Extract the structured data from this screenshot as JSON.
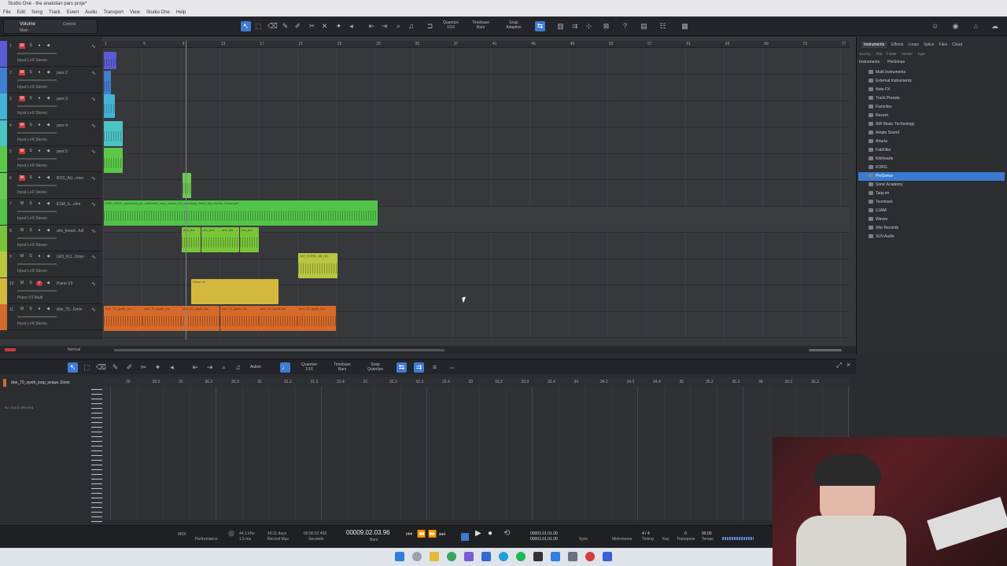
{
  "window": {
    "title": "Studio One - the anatolian pars proje*"
  },
  "menu": [
    "File",
    "Edit",
    "Song",
    "Track",
    "Event",
    "Audio",
    "Transport",
    "View",
    "Studio One",
    "Help"
  ],
  "toolbar": {
    "volume_label": "Volume",
    "volume_sub": "Main",
    "control_label": "Control",
    "quantize_label": "Quantize",
    "quantize_val": "1/16",
    "timebase_label": "Timebase",
    "timebase_val": "Bars",
    "snap_label": "Snap",
    "snap_val": "Adaptive"
  },
  "ruler": [
    "1",
    "5",
    "9",
    "13",
    "17",
    "21",
    "25",
    "29",
    "33",
    "37",
    "41",
    "45",
    "49",
    "53",
    "57",
    "61",
    "65",
    "69",
    "73",
    "77"
  ],
  "tracks": [
    {
      "num": "1",
      "name": "",
      "input": "Input L+R   Stereo",
      "color": "#5b5bd6",
      "mute": true
    },
    {
      "num": "2",
      "name": "pars 2",
      "input": "Input L+R   Stereo",
      "color": "#3f7fd0",
      "mute": true
    },
    {
      "num": "3",
      "name": "pars 3",
      "input": "Input L+R   Stereo",
      "color": "#43b4d8",
      "mute": true
    },
    {
      "num": "4",
      "name": "pars 4",
      "input": "Input L+R   Stereo",
      "color": "#4cc4c4",
      "mute": true
    },
    {
      "num": "5",
      "name": "pars 5",
      "input": "Input L+R   Stereo",
      "color": "#5cc84a",
      "mute": true
    },
    {
      "num": "6",
      "name": "BOS_AU...mon",
      "input": "Input L+R   Stereo",
      "color": "#6acb52",
      "mute": true
    },
    {
      "num": "7",
      "name": "ESM_S...ckm",
      "input": "Input L+R   Stereo",
      "color": "#52c44a",
      "mute": false
    },
    {
      "num": "8",
      "name": "ahs_feeart...full",
      "input": "Input L+R   Stereo",
      "color": "#7ac43a",
      "mute": false
    },
    {
      "num": "9",
      "name": "GIO_KO...Dmin",
      "input": "Input L+R   Stereo",
      "color": "#b8c640",
      "mute": false
    },
    {
      "num": "10",
      "name": "Piano V3",
      "input": "Piano V3     Multi",
      "color": "#d4b83e",
      "mute": false
    },
    {
      "num": "11",
      "name": "doe_70...Dmin",
      "input": "Input L+R   Stereo",
      "color": "#d66a2a",
      "mute": false
    }
  ],
  "clips": {
    "esm": "ESM_SKOL_pianosolo_pc_ambience_loop_cream_full_drumloop_feem_full_chords_fullsample",
    "ahs": "ahs_fea",
    "gio": "GIO_KORG_85_Dm",
    "piano": "Piano V3",
    "doe": "doe_70_synth_loo"
  },
  "browser": {
    "tabs": [
      "Instruments",
      "Effects",
      "Loops",
      "Splice",
      "Files",
      "Cloud"
    ],
    "filters": [
      "Sort by:",
      "Flat",
      "Folder",
      "Vendor",
      "Type"
    ],
    "path": [
      "Instruments",
      "PreSonus"
    ],
    "items": [
      "Multi Instruments",
      "External Instruments",
      "Note FX",
      "Track Presets",
      "Favorites",
      "Recent",
      "AIR Music Technology",
      "Ample Sound",
      "Arturia",
      "FabFilter",
      "Kilohearts",
      "KORG",
      "PreSonus",
      "Sonic Academy",
      "Taqs.im",
      "Toontrack",
      "UJAM",
      "Waves",
      "Xfer Records",
      "XLN Audio"
    ],
    "selected": "PreSonus"
  },
  "editor": {
    "track": "doe_70_synth_loop_seque..Dmin",
    "no_chord": "No chord selected",
    "action": "Action",
    "quantize_label": "Quantize",
    "quantize_val": "1/16",
    "timebase_label": "Timebase",
    "timebase_val": "Bars",
    "snap_label": "Snap",
    "snap_val": "Quantize",
    "ruler": [
      "29",
      "29.2",
      "30",
      "30.2",
      "30.3",
      "31",
      "31.2",
      "31.3",
      "31.4",
      "32",
      "32.2",
      "32.3",
      "32.4",
      "33",
      "33.2",
      "33.3",
      "33.4",
      "34",
      "34.2",
      "34.3",
      "34.4",
      "35",
      "35.2",
      "35.3",
      "36",
      "36.2",
      "36.3"
    ]
  },
  "transport": {
    "rate": "44.1 kHz",
    "rate_sub": "1.5 ms",
    "record_max": "43:11 days",
    "record_max_label": "Record Max",
    "seconds": "00:00:22.493",
    "seconds_label": "Seconds",
    "bars": "00009.02.03.96",
    "bars_label": "Bars",
    "loop_start": "00001.01.01.00",
    "loop_end": "00001.01.01.00",
    "sync": "Sync",
    "metronome": "Metronome",
    "timing": "Timing",
    "sig": "4 / 4",
    "key": "Key",
    "transpose": "0",
    "transpose_label": "Transpose",
    "tempo": "90.00",
    "tempo_label": "Tempo",
    "mid": "MIDI",
    "perf": "Performance"
  },
  "arr_bottom": {
    "mode": "Normal"
  },
  "colors": {
    "accent": "#3e7bd6",
    "bg": "#36383c"
  }
}
